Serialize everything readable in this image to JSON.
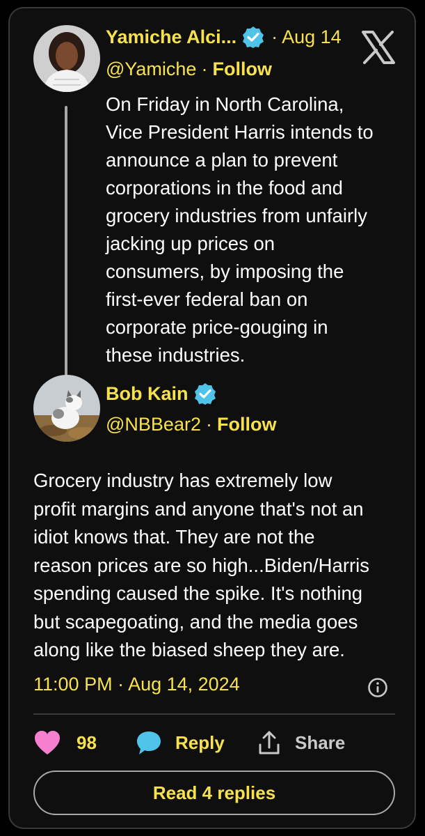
{
  "original_tweet": {
    "author_name": "Yamiche Alci...",
    "handle": "@Yamiche",
    "date": "Aug 14",
    "follow_label": "Follow",
    "text": "On Friday in North Carolina,\nVice President Harris intends to\nannounce a plan to prevent\ncorporations in the food and\ngrocery industries from unfairly\njacking up prices on\nconsumers, by imposing the\nfirst-ever federal ban on\ncorporate price-gouging in\nthese industries."
  },
  "reply_tweet": {
    "author_name": "Bob Kain",
    "handle": "@NBBear2",
    "follow_label": "Follow",
    "text": "Grocery industry has extremely low\nprofit margins and anyone that's not an\nidiot knows that.  They are not the\nreason prices are so high...Biden/Harris\nspending caused the spike.  It's nothing\nbut scapegoating, and the media goes\nalong like the biased sheep they are.",
    "timestamp": "11:00 PM · Aug 14, 2024"
  },
  "separators": {
    "dot": "·"
  },
  "actions": {
    "like_count": "98",
    "reply_label": "Reply",
    "share_label": "Share"
  },
  "read_replies_label": "Read 4 replies",
  "icons": [
    "verified-badge-icon",
    "x-logo-icon",
    "info-icon",
    "heart-icon",
    "reply-bubble-icon",
    "share-icon"
  ],
  "colors": {
    "accent_yellow": "#f7e24d",
    "verified_blue": "#4fc4e8",
    "heart_pink": "#f77fcf",
    "bubble_blue": "#4fc4e8",
    "background": "#0f0f10"
  }
}
